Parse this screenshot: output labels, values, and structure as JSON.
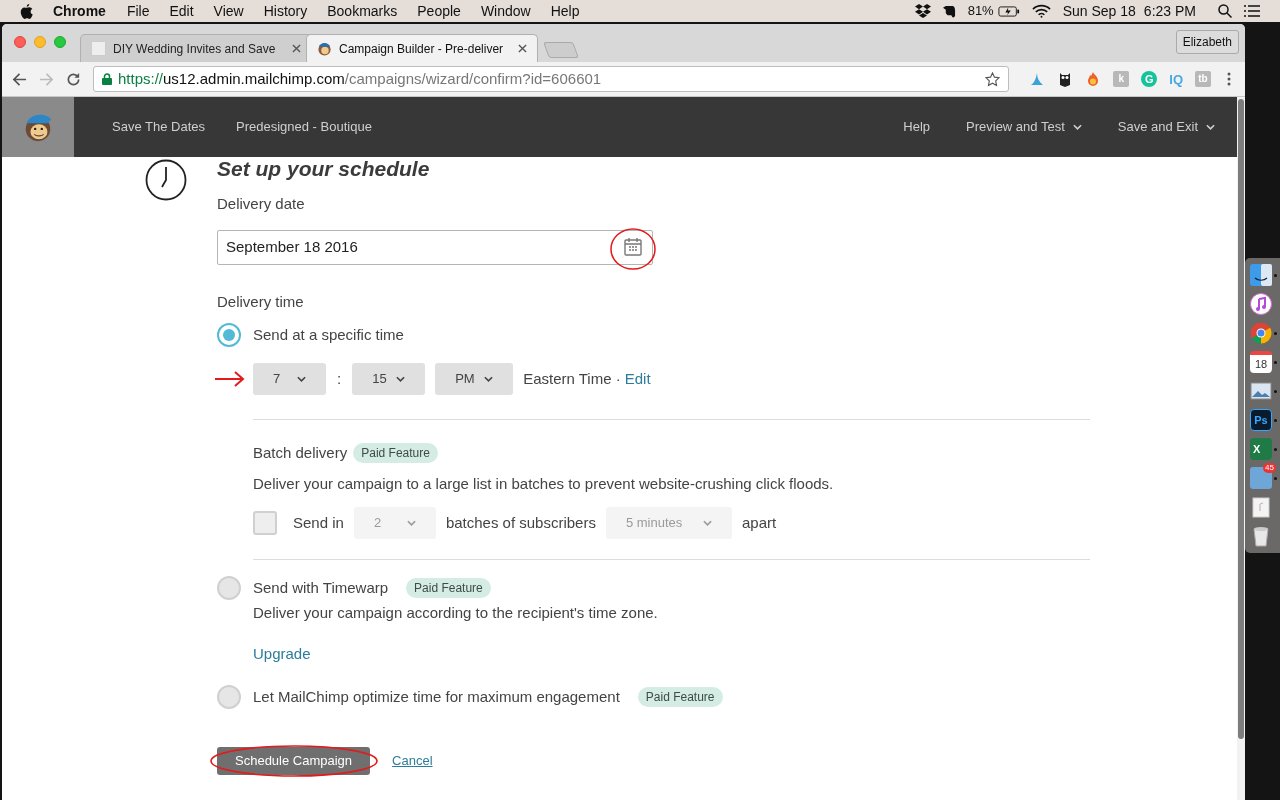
{
  "menubar": {
    "app": "Chrome",
    "menus": [
      "File",
      "Edit",
      "View",
      "History",
      "Bookmarks",
      "People",
      "Window",
      "Help"
    ],
    "battery": "81%",
    "date": "Sun Sep 18",
    "time": "6:23 PM"
  },
  "browser": {
    "tabs": [
      {
        "title": "DIY Wedding Invites and Save",
        "selected": false
      },
      {
        "title": "Campaign Builder - Pre-deliver",
        "selected": true
      }
    ],
    "profile": "Elizabeth",
    "url": {
      "scheme": "https://",
      "host": "us12.admin.mailchimp.com",
      "path": "/campaigns/wizard/confirm?id=606601"
    },
    "extensions": [
      {
        "kind": "wing"
      },
      {
        "kind": "owl"
      },
      {
        "kind": "flame"
      },
      {
        "kind": "tile",
        "text": "k"
      },
      {
        "kind": "round",
        "text": "G"
      },
      {
        "kind": "plain",
        "text": "IQ"
      },
      {
        "kind": "tile",
        "text": "tb"
      }
    ]
  },
  "nav": {
    "left": [
      "Save The Dates",
      "Predesigned - Boutique"
    ],
    "right": [
      {
        "label": "Help",
        "dropdown": false
      },
      {
        "label": "Preview and Test",
        "dropdown": true
      },
      {
        "label": "Save and Exit",
        "dropdown": true
      }
    ]
  },
  "schedule": {
    "title": "Set up your schedule",
    "date_label": "Delivery date",
    "date_value": "September 18 2016",
    "time_label": "Delivery time",
    "options": [
      {
        "kind": "specific",
        "label": "Send at a specific time",
        "selected": true
      },
      {
        "kind": "timewarp",
        "label": "Send with Timewarp",
        "badge": "Paid Feature",
        "selected": false
      },
      {
        "kind": "optimize",
        "label": "Let MailChimp optimize time for maximum engagement",
        "badge": "Paid Feature",
        "selected": false
      }
    ],
    "time": {
      "hour": "7",
      "separator": ":",
      "minute": "15",
      "ampm": "PM",
      "zone": "Eastern Time ·",
      "edit": "Edit"
    },
    "batch": {
      "title": "Batch delivery",
      "badge": "Paid Feature",
      "description": "Deliver your campaign to a large list in batches to prevent website-crushing click floods.",
      "checked": false,
      "send_in": "Send in",
      "count": "2",
      "middle": "batches of subscribers",
      "interval": "5 minutes",
      "end": "apart"
    },
    "timewarp": {
      "description": "Deliver your campaign according to the recipient's time zone.",
      "link": "Upgrade"
    },
    "buttons": {
      "primary": "Schedule Campaign",
      "cancel": "Cancel"
    }
  },
  "dock": [
    {
      "kind": "finder",
      "running": true
    },
    {
      "kind": "music",
      "running": false
    },
    {
      "kind": "chrome",
      "running": true
    },
    {
      "kind": "calendar",
      "text": "18",
      "running": true
    },
    {
      "kind": "preview",
      "running": true
    },
    {
      "kind": "photoshop",
      "text": "Ps",
      "running": true
    },
    {
      "kind": "excel",
      "text": "X",
      "running": true
    },
    {
      "kind": "mail",
      "badge": "45",
      "running": true
    },
    {
      "kind": "folder",
      "running": false
    },
    {
      "kind": "trash",
      "running": false
    }
  ]
}
